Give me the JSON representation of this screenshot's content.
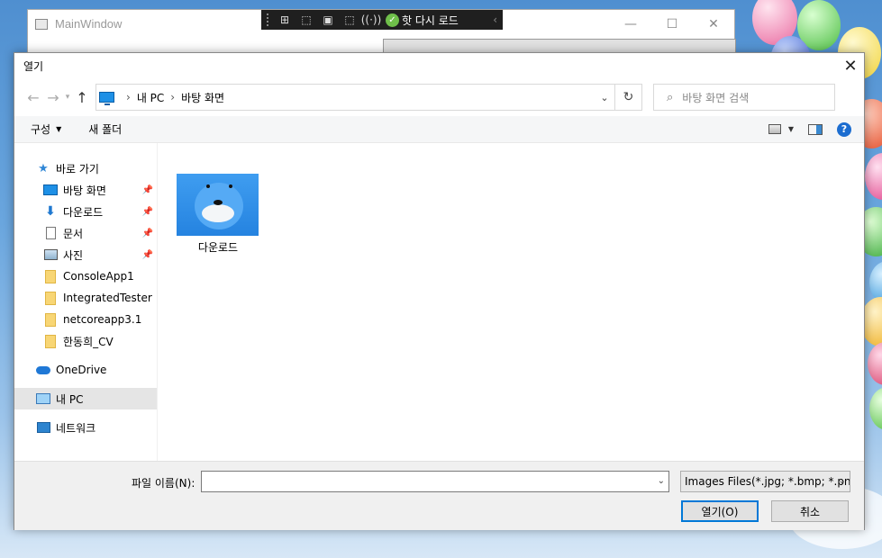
{
  "main_window": {
    "title": "MainWindow"
  },
  "xaml_toolbar": {
    "hot_reload_label": "핫 다시 로드"
  },
  "dialog": {
    "title": "열기",
    "address": {
      "crumbs": [
        "내 PC",
        "바탕 화면"
      ]
    },
    "search": {
      "placeholder": "바탕 화면 검색"
    },
    "commands": {
      "organize": "구성",
      "new_folder": "새 폴더"
    },
    "sidebar": {
      "quick_access": "바로 가기",
      "pinned": [
        {
          "label": "바탕 화면",
          "icon": "desktop-icon"
        },
        {
          "label": "다운로드",
          "icon": "download-icon"
        },
        {
          "label": "문서",
          "icon": "document-icon"
        },
        {
          "label": "사진",
          "icon": "pictures-icon"
        }
      ],
      "folders": [
        "ConsoleApp1",
        "IntegratedTester",
        "netcoreapp3.1",
        "한동희_CV"
      ],
      "onedrive": "OneDrive",
      "this_pc": "내 PC",
      "network": "네트워크"
    },
    "files": [
      {
        "name": "다운로드"
      }
    ],
    "footer": {
      "filename_label": "파일 이름(N):",
      "filename_value": "",
      "filter": "Images Files(*.jpg; *.bmp; *.png)",
      "open_button": "열기(O)",
      "cancel_button": "취소"
    }
  },
  "colors": {
    "accent": "#0078d7",
    "selection": "#e5e5e5",
    "folder": "#f8d675"
  }
}
